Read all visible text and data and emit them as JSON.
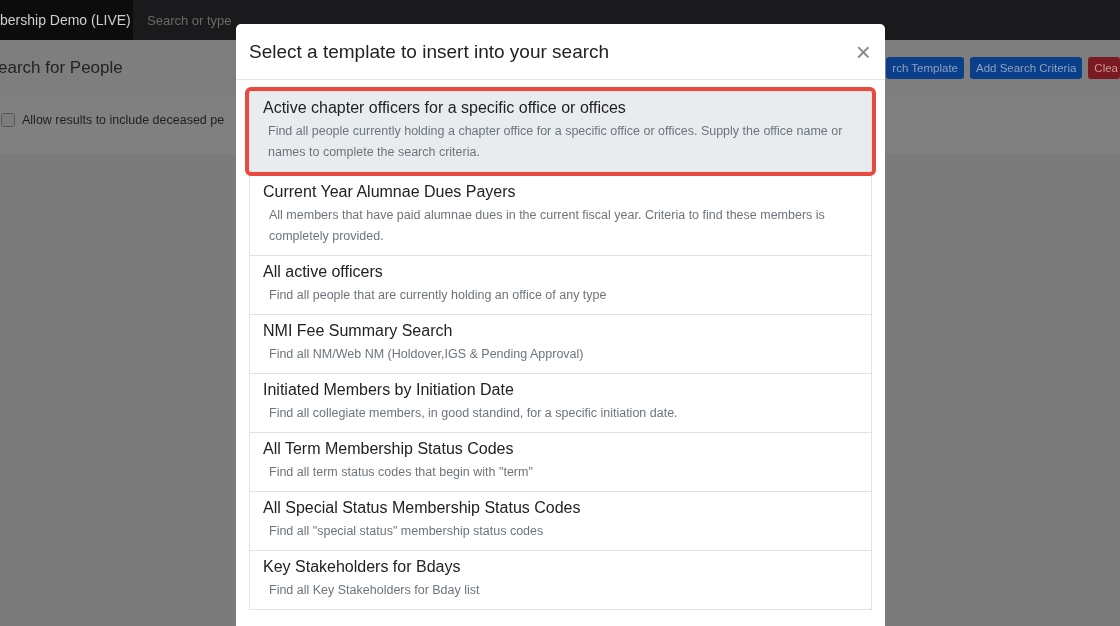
{
  "navbar": {
    "brand": "bership Demo (LIVE)",
    "search": {
      "placeholder": "Search or type"
    }
  },
  "page": {
    "title": "earch for People",
    "buttons": [
      {
        "label": "rch Template",
        "kind": "primary"
      },
      {
        "label": "Add Search Criteria",
        "kind": "primary"
      },
      {
        "label": "Clea",
        "kind": "danger"
      }
    ],
    "deceased_option": {
      "label": "Allow results to include deceased pe",
      "checked": false
    }
  },
  "modal": {
    "title": "Select a template to insert into your search",
    "close": "×",
    "templates": [
      {
        "name": "Active chapter officers for a specific office or offices",
        "description": "Find all people currently holding a chapter office for a specific office or offices. Supply the office name or names to complete the search criteria.",
        "selected": true
      },
      {
        "name": "Current Year Alumnae Dues Payers",
        "description": "All members that have paid alumnae dues in the current fiscal year. Criteria to find these members is completely provided.",
        "selected": false
      },
      {
        "name": "All active officers",
        "description": "Find all people that are currently holding an office of any type",
        "selected": false
      },
      {
        "name": "NMI Fee Summary Search",
        "description": "Find all NM/Web NM (Holdover,IGS & Pending Approval)",
        "selected": false
      },
      {
        "name": "Initiated Members by Initiation Date",
        "description": "Find all collegiate members, in good standind, for a specific initiation date.",
        "selected": false
      },
      {
        "name": "All Term Membership Status Codes",
        "description": "Find all term status codes that begin with \"term\"",
        "selected": false
      },
      {
        "name": "All Special Status Membership Status Codes",
        "description": "Find all \"special status\" membership status codes",
        "selected": false
      },
      {
        "name": "Key Stakeholders for Bdays",
        "description": "Find all Key Stakeholders for Bday list",
        "selected": false
      }
    ]
  }
}
